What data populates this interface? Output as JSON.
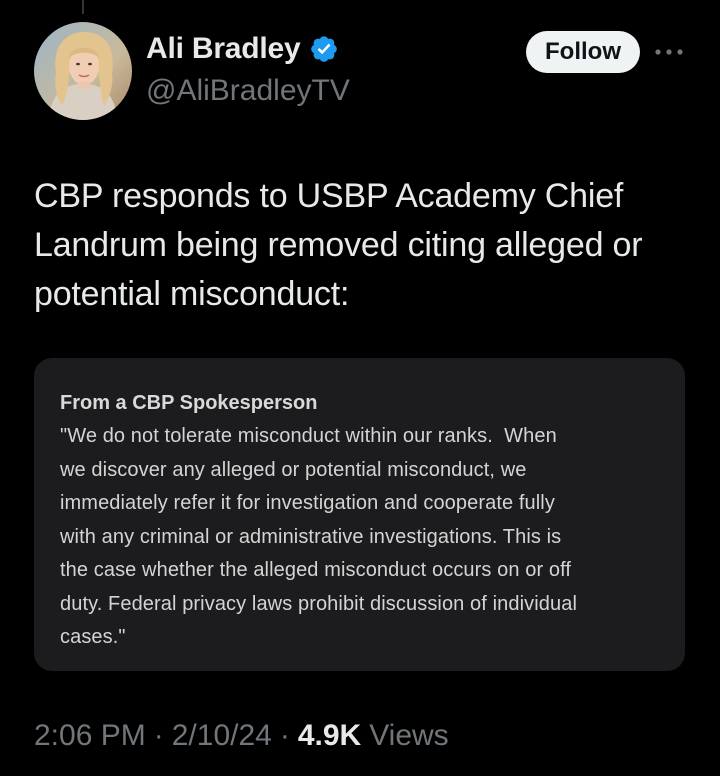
{
  "tweet": {
    "author": {
      "display_name": "Ali Bradley",
      "handle": "@AliBradleyTV",
      "verified": true,
      "avatar_icon": "profile-photo"
    },
    "follow_label": "Follow",
    "more_icon": "more-horizontal-icon",
    "text": "CBP responds to USBP Academy Chief Landrum being removed citing alleged or potential misconduct:",
    "quoted_statement": {
      "title": "From a CBP Spokesperson",
      "body": "\"We do not tolerate misconduct within our ranks.  When\nwe discover any alleged or potential misconduct, we\nimmediately refer it for investigation and cooperate fully\nwith any criminal or administrative investigations. This is\nthe case whether the alleged misconduct occurs on or off\nduty. Federal privacy laws prohibit discussion of individual\ncases.\""
    },
    "meta": {
      "time": "2:06 PM",
      "separator": "·",
      "date": "2/10/24",
      "views_count": "4.9K",
      "views_label": "Views"
    }
  },
  "colors": {
    "background": "#000000",
    "text_primary": "#e7e9ea",
    "text_secondary": "#71767b",
    "verified_badge": "#1d9bf0",
    "follow_button_bg": "#eff3f4",
    "follow_button_text": "#0f1419",
    "card_bg": "#1c1c1e"
  }
}
